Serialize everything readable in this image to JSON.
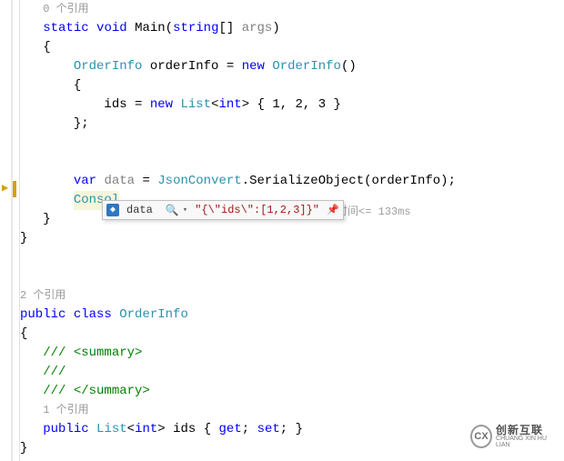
{
  "refs": {
    "main": "0 个引用",
    "orderinfo_class": "2 个引用",
    "ids_prop": "1 个引用"
  },
  "code": {
    "static": "static",
    "void": "void",
    "main": "Main",
    "string_arr": "string",
    "brackets": "[]",
    "args": "args",
    "lparen": "(",
    "rparen": ")",
    "lbrace": "{",
    "rbrace": "}",
    "orderinfo_type": "OrderInfo",
    "orderinfo_var": "orderInfo",
    "assign": " = ",
    "new_kw": "new",
    "ctor_paren": "()",
    "ids_name": "ids",
    "list_type": "List",
    "lt": "<",
    "int_type": "int",
    "gt": ">",
    "arr_init": " { 1, 2, 3 }",
    "rbrace_semi": "};",
    "var_kw": "var",
    "data_var": "data",
    "jsonconvert": "JsonConvert",
    "dot": ".",
    "serialize": "SerializeObject",
    "orderinfo_arg": "orderInfo",
    "semi": ";",
    "console_partial": "Consol",
    "public_kw": "public",
    "class_kw": "class",
    "summary_open": "/// <summary>",
    "summary_mid": "/// ",
    "summary_close": "/// </summary>",
    "autoprop": " { ",
    "get_kw": "get",
    "set_kw": "set",
    "autoprop_end": " }"
  },
  "datatip": {
    "variable_name": "data",
    "value": "\"{\\\"ids\\\":[1,2,3]}\""
  },
  "perf": {
    "label": "时间",
    "op": "<=",
    "ms": "133ms"
  },
  "watermark": {
    "logo_text": "CX",
    "cn": "创新互联",
    "en": "CHUANG XIN HU LIAN"
  }
}
